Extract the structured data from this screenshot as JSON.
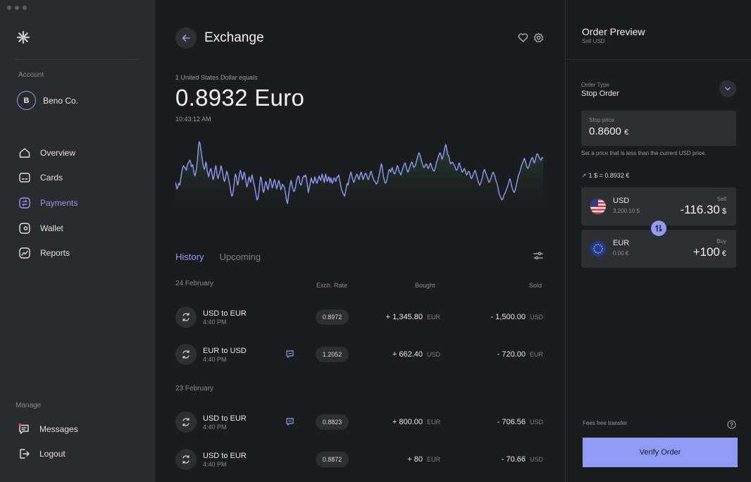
{
  "sidebar": {
    "account_label": "Account",
    "account": {
      "initial": "B",
      "name": "Beno Co."
    },
    "nav": [
      {
        "label": "Overview",
        "icon": "home-icon"
      },
      {
        "label": "Cards",
        "icon": "card-icon"
      },
      {
        "label": "Payments",
        "icon": "payments-icon",
        "active": true
      },
      {
        "label": "Wallet",
        "icon": "wallet-icon"
      },
      {
        "label": "Reports",
        "icon": "reports-icon"
      }
    ],
    "manage_label": "Manage",
    "manage": [
      {
        "label": "Messages",
        "icon": "messages-icon"
      },
      {
        "label": "Logout",
        "icon": "logout-icon"
      }
    ]
  },
  "header": {
    "title": "Exchange"
  },
  "rate": {
    "label": "1 United States Dollar equals",
    "value": "0.8932 Euro",
    "time": "10:43:12 AM"
  },
  "chart_data": {
    "type": "area",
    "color": "#8f9bf5",
    "values": [
      46,
      43,
      39,
      40,
      44,
      45,
      43,
      48,
      53,
      58,
      62,
      64,
      63,
      62,
      61,
      59,
      63,
      66,
      67,
      69,
      70,
      68,
      63,
      64,
      65,
      60,
      55,
      53,
      56,
      60,
      67,
      75,
      86,
      90,
      88,
      83,
      78,
      72,
      66,
      63,
      60,
      62,
      68,
      66,
      59,
      55,
      52,
      56,
      59,
      61,
      58,
      54,
      49,
      51,
      56,
      61,
      64,
      59,
      53,
      50,
      53,
      56,
      59,
      64,
      62,
      58,
      54,
      49,
      47,
      50,
      54,
      58,
      56,
      52,
      48,
      44,
      40,
      34,
      31,
      32,
      36,
      43,
      50,
      55,
      53,
      48,
      43,
      45,
      51,
      56,
      59,
      56,
      52,
      49,
      53,
      57,
      55,
      50,
      45,
      41,
      44,
      49,
      52,
      49,
      46,
      50,
      54,
      51,
      47,
      43,
      40,
      35,
      31,
      27,
      28,
      32,
      39,
      47,
      52,
      50,
      44,
      38,
      35,
      38,
      43,
      47,
      45,
      41,
      38,
      41,
      46,
      50,
      48,
      44,
      40,
      42,
      46,
      49,
      47,
      43,
      39,
      41,
      45,
      48,
      46,
      42,
      38,
      40,
      44,
      43,
      42,
      40,
      36,
      31,
      26,
      23,
      28,
      35,
      40,
      44,
      48,
      45,
      41,
      38,
      36,
      37,
      40,
      45,
      49,
      51,
      53,
      52,
      46,
      44,
      43,
      46,
      50,
      52,
      53,
      52,
      54,
      52,
      47,
      41,
      35,
      39,
      43,
      47,
      51,
      48,
      46,
      45,
      48,
      52,
      49,
      46,
      45,
      48,
      51,
      53,
      50,
      48,
      51,
      55,
      52,
      49,
      46,
      51,
      55,
      51,
      47,
      49,
      52,
      50,
      46,
      51,
      48,
      45,
      47,
      50,
      51,
      49,
      47,
      50,
      52,
      52,
      54,
      50,
      46,
      42,
      38,
      36,
      34,
      33,
      31,
      34,
      38,
      43,
      45,
      43,
      48,
      52,
      55,
      57,
      54,
      50,
      48,
      46,
      48,
      51,
      53,
      55,
      54,
      51,
      49,
      52,
      55,
      57,
      55,
      51,
      49,
      52,
      54,
      56,
      55,
      53,
      50,
      49,
      51,
      54,
      57,
      58,
      55,
      52,
      50,
      48,
      47,
      46,
      44,
      45,
      47,
      51,
      54,
      58,
      62,
      66,
      64,
      58,
      52,
      49,
      46,
      45,
      47,
      50,
      54,
      58,
      60,
      59,
      57,
      60,
      62,
      59,
      57,
      55,
      56,
      58,
      61,
      64,
      63,
      60,
      57,
      56,
      54,
      57,
      59,
      62,
      64,
      66,
      67,
      64,
      61,
      58,
      57,
      59,
      62,
      64,
      66,
      68,
      67,
      64,
      62,
      63,
      64,
      67,
      70,
      73,
      76,
      78,
      77,
      74,
      71,
      68,
      66,
      63,
      62,
      63,
      65,
      66,
      65,
      62,
      61,
      63,
      65,
      67,
      65,
      62,
      60,
      59,
      58,
      60,
      63,
      66,
      69,
      71,
      74,
      76,
      78,
      77,
      74,
      71,
      73,
      76,
      80,
      84,
      87,
      85,
      80,
      76,
      75,
      72,
      68,
      66,
      67,
      68,
      67,
      66,
      64,
      63,
      60,
      59,
      60,
      62,
      66,
      67,
      64,
      62,
      59,
      57,
      58,
      60,
      61,
      59,
      56,
      54,
      55,
      57,
      58,
      57,
      54,
      51,
      50,
      52,
      54,
      56,
      58,
      59,
      56,
      53,
      50,
      47,
      45,
      43,
      44,
      46,
      49,
      52,
      56,
      59,
      60,
      57,
      55,
      53,
      51,
      48,
      46,
      47,
      49,
      51,
      54,
      56,
      57,
      55,
      53,
      50,
      47,
      45,
      42,
      38,
      34,
      32,
      30,
      28,
      27,
      28,
      30,
      33,
      34,
      36,
      38,
      40,
      42,
      45,
      48,
      50,
      47,
      44,
      40,
      38,
      36,
      35,
      37,
      40,
      44,
      47,
      51,
      54,
      56,
      58,
      61,
      64,
      66,
      68,
      70,
      72,
      70,
      67,
      64,
      62,
      61,
      63,
      65,
      68,
      70,
      72,
      73,
      71,
      68,
      67,
      70,
      73,
      76,
      77,
      76,
      74,
      72,
      71,
      70,
      72,
      73,
      72
    ]
  },
  "history": {
    "tabs": [
      "History",
      "Upcoming"
    ],
    "columns": {
      "rate": "Exch. Rate",
      "bought": "Bought",
      "sold": "Sold"
    },
    "groups": [
      {
        "date": "24 February",
        "rows": [
          {
            "title": "USD to EUR",
            "time": "4:40 PM",
            "rate": "0.8972",
            "bought": "+ 1,345.80",
            "bought_cur": "EUR",
            "sold": "- 1,500.00",
            "sold_cur": "USD",
            "comment": false
          },
          {
            "title": "EUR to USD",
            "time": "4:40 PM",
            "rate": "1.2052",
            "bought": "+ 662.40",
            "bought_cur": "USD",
            "sold": "- 720.00",
            "sold_cur": "EUR",
            "comment": true
          }
        ]
      },
      {
        "date": "23 February",
        "rows": [
          {
            "title": "USD to EUR",
            "time": "4:40 PM",
            "rate": "0.8823",
            "bought": "+ 800.00",
            "bought_cur": "EUR",
            "sold": "- 706.56",
            "sold_cur": "USD",
            "comment": true
          },
          {
            "title": "USD to EUR",
            "time": "4:40 PM",
            "rate": "0.8872",
            "bought": "+ 80",
            "bought_cur": "EUR",
            "sold": "- 70.66",
            "sold_cur": "USD",
            "comment": false
          }
        ]
      }
    ]
  },
  "order": {
    "title": "Order Preview",
    "subtitle": "Sell USD",
    "type_label": "Order Type",
    "type_value": "Stop Order",
    "stop_label": "Stop price",
    "stop_value": "0.8600",
    "stop_symbol": "€",
    "hint": "Set a price that is less than the current USD price.",
    "current_rate": "1 $ = 0.8932 €",
    "sell": {
      "code": "USD",
      "balance": "3,200.10 $",
      "type": "Sell",
      "amount": "-116.30",
      "symbol": "$"
    },
    "buy": {
      "code": "EUR",
      "balance": "0.00 €",
      "type": "Buy",
      "amount": "+100",
      "symbol": "€"
    },
    "fees": "Fees free transfer",
    "verify": "Verify Order"
  }
}
